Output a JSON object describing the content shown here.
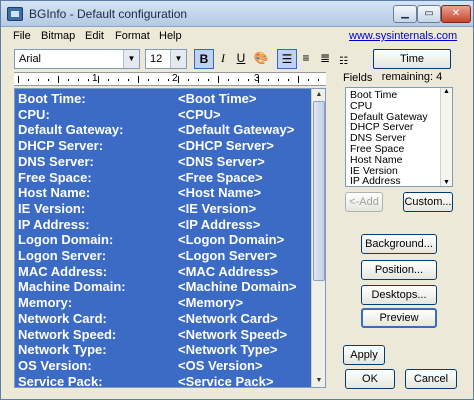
{
  "window": {
    "title": "BGInfo - Default configuration"
  },
  "titlebar": {
    "min_glyph": "▁",
    "max_glyph": "▭",
    "close_glyph": "✕"
  },
  "menu": {
    "items": [
      "File",
      "Bitmap",
      "Edit",
      "Format",
      "Help"
    ],
    "link": "www.sysinternals.com"
  },
  "toolbar": {
    "font": "Arial",
    "size": "12",
    "bold": "B",
    "italic": "I",
    "underline": "U",
    "time_remaining": "Time remaining: 4"
  },
  "ruler": {
    "numbers": [
      "1",
      "2",
      "3"
    ]
  },
  "editor": {
    "lines": [
      {
        "label": "Boot Time:",
        "value": "<Boot Time>"
      },
      {
        "label": "CPU:",
        "value": "<CPU>"
      },
      {
        "label": "Default Gateway:",
        "value": "<Default Gateway>"
      },
      {
        "label": "DHCP Server:",
        "value": "<DHCP Server>"
      },
      {
        "label": "DNS Server:",
        "value": "<DNS Server>"
      },
      {
        "label": "Free Space:",
        "value": "<Free Space>"
      },
      {
        "label": "Host Name:",
        "value": "<Host Name>"
      },
      {
        "label": "IE Version:",
        "value": "<IE Version>"
      },
      {
        "label": "IP Address:",
        "value": "<IP Address>"
      },
      {
        "label": "Logon Domain:",
        "value": "<Logon Domain>"
      },
      {
        "label": "Logon Server:",
        "value": "<Logon Server>"
      },
      {
        "label": "MAC Address:",
        "value": "<MAC Address>"
      },
      {
        "label": "Machine Domain:",
        "value": "<Machine Domain>"
      },
      {
        "label": "Memory:",
        "value": "<Memory>"
      },
      {
        "label": "Network Card:",
        "value": "<Network Card>"
      },
      {
        "label": "Network Speed:",
        "value": "<Network Speed>"
      },
      {
        "label": "Network Type:",
        "value": "<Network Type>"
      },
      {
        "label": "OS Version:",
        "value": "<OS Version>"
      },
      {
        "label": "Service Pack:",
        "value": "<Service Pack>"
      }
    ]
  },
  "fields": {
    "label": "Fields",
    "items": [
      "Boot Time",
      "CPU",
      "Default Gateway",
      "DHCP Server",
      "DNS Server",
      "Free Space",
      "Host Name",
      "IE Version",
      "IP Address"
    ],
    "add_button": "<-Add",
    "custom_button": "Custom..."
  },
  "actions": {
    "background": "Background...",
    "position": "Position...",
    "desktops": "Desktops...",
    "preview": "Preview",
    "apply": "Apply",
    "ok": "OK",
    "cancel": "Cancel"
  },
  "colors": {
    "selection": "#3b6bc4",
    "selection_text": "#ffffff",
    "link": "#0000cc"
  }
}
